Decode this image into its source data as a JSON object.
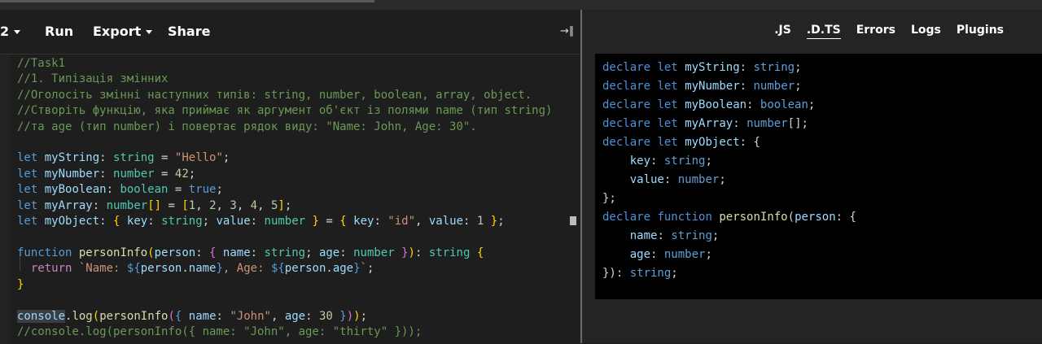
{
  "toolbar": {
    "version_label": "2",
    "run_label": "Run",
    "export_label": "Export",
    "share_label": "Share",
    "collapse_glyph": "→∥"
  },
  "output_tabs": [
    ".JS",
    ".D.TS",
    "Errors",
    "Logs",
    "Plugins"
  ],
  "active_tab": ".D.TS",
  "editor": {
    "comment_1": "//Task1",
    "comment_2": "//1. Типізація змінних",
    "comment_3": "//Оголосіть змінні наступних типів: string, number, boolean, array, object.",
    "comment_4": "//Створіть функцію, яка приймає як аргумент об'єкт із полями name (тип string)",
    "comment_5": "//та age (тип number) і повертає рядок виду: \"Name: John, Age: 30\".",
    "last_comment": "//console.log(personInfo({ name: \"John\", age: \"thirty\" }));"
  },
  "colors": {
    "comment": "#6a9955",
    "keyword": "#569cd6",
    "variable": "#9cdcfe",
    "string": "#ce9178",
    "number": "#b5cea8",
    "function": "#dcdcaa",
    "output_bg": "#000000"
  }
}
